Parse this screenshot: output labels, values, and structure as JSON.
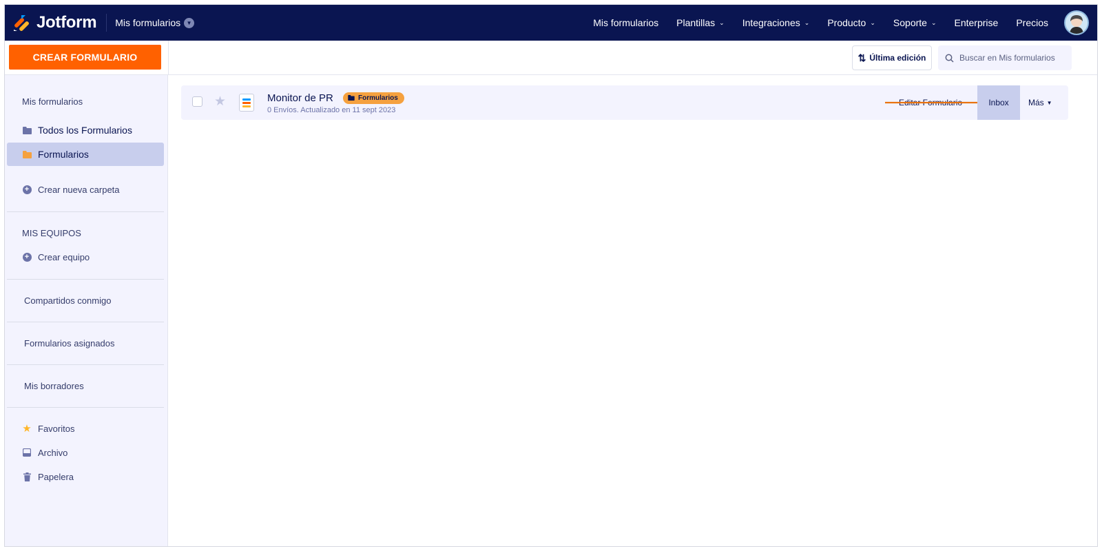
{
  "app": {
    "brand": "Jotform",
    "workspace_label": "Mis formularios"
  },
  "nav": {
    "items": [
      {
        "label": "Mis formularios",
        "has_menu": false
      },
      {
        "label": "Plantillas",
        "has_menu": true
      },
      {
        "label": "Integraciones",
        "has_menu": true
      },
      {
        "label": "Producto",
        "has_menu": true
      },
      {
        "label": "Soporte",
        "has_menu": true
      },
      {
        "label": "Enterprise",
        "has_menu": false
      },
      {
        "label": "Precios",
        "has_menu": false
      }
    ]
  },
  "toolbar": {
    "create_label": "CREAR FORMULARIO",
    "sort_label": "Última edición",
    "search_placeholder": "Buscar en Mis formularios"
  },
  "sidebar": {
    "heading_forms": "Mis formularios",
    "items": [
      {
        "label": "Todos los Formularios",
        "icon": "folder-icon",
        "active": false
      },
      {
        "label": "Formularios",
        "icon": "folder-icon",
        "active": true
      }
    ],
    "create_folder": "Crear nueva carpeta",
    "teams_heading": "MIS EQUIPOS",
    "create_team": "Crear equipo",
    "shared": "Compartidos conmigo",
    "assigned": "Formularios asignados",
    "drafts": "Mis borradores",
    "favorites": "Favoritos",
    "archive": "Archivo",
    "trash": "Papelera"
  },
  "forms": [
    {
      "title": "Monitor de PR",
      "folder_tag": "Formularios",
      "meta": "0 Envíos. Actualizado en 11 sept 2023",
      "edit_label": "Editar Formulario",
      "inbox_label": "Inbox",
      "more_label": "Más"
    }
  ],
  "colors": {
    "nav_bg": "#0a1551",
    "accent": "#ff6100",
    "sidebar_bg": "#f3f3fe",
    "active_item": "#c8ceed",
    "folder_orange": "#f5a13f",
    "folder_purple": "#6c73a8"
  }
}
